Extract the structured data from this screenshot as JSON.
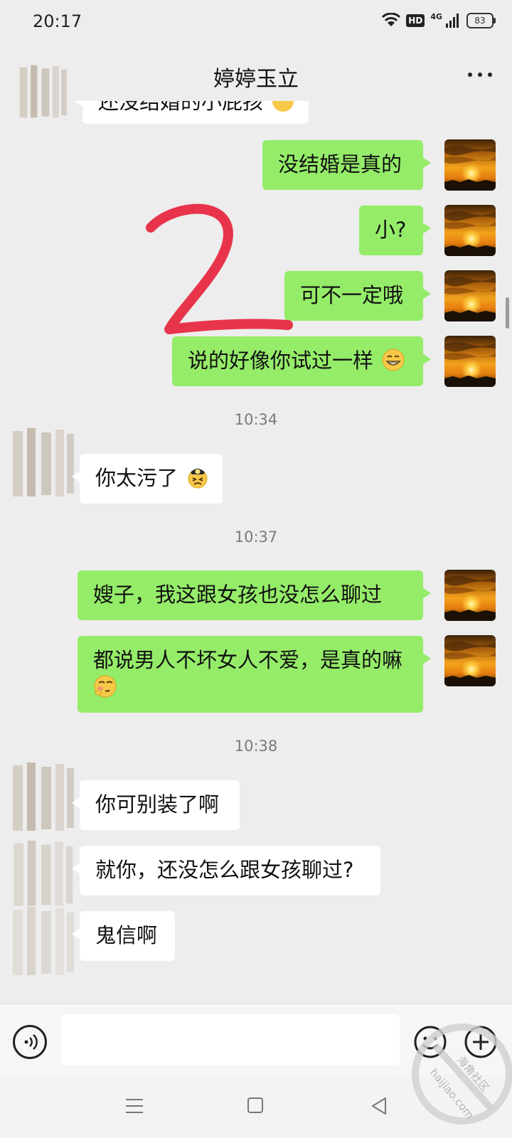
{
  "status_bar": {
    "time": "20:17",
    "hd": "HD",
    "network": "4G",
    "battery": "83"
  },
  "header": {
    "title": "婷婷玉立"
  },
  "messages": {
    "partial_top": "还没结婚的小屁孩",
    "m1": "没结婚是真的",
    "m2": "小?",
    "m3": "可不一定哦",
    "m4": "说的好像你试过一样",
    "time1": "10:34",
    "m5": "你太污了",
    "time2": "10:37",
    "m6": "嫂子，我这跟女孩也没怎么聊过",
    "m7": "都说男人不坏女人不爱，是真的嘛",
    "time3": "10:38",
    "m8": "你可别装了啊",
    "m9": "就你，还没怎么跟女孩聊过?",
    "m10": "鬼信啊"
  },
  "annotation": {
    "handwritten": "2"
  },
  "input": {
    "value": ""
  },
  "watermark": {
    "text": "海角社区",
    "url": "haijiao.com"
  },
  "colors": {
    "outgoing_bubble": "#95ec69",
    "incoming_bubble": "#ffffff",
    "background": "#ededed",
    "annotation": "#e8344a"
  }
}
